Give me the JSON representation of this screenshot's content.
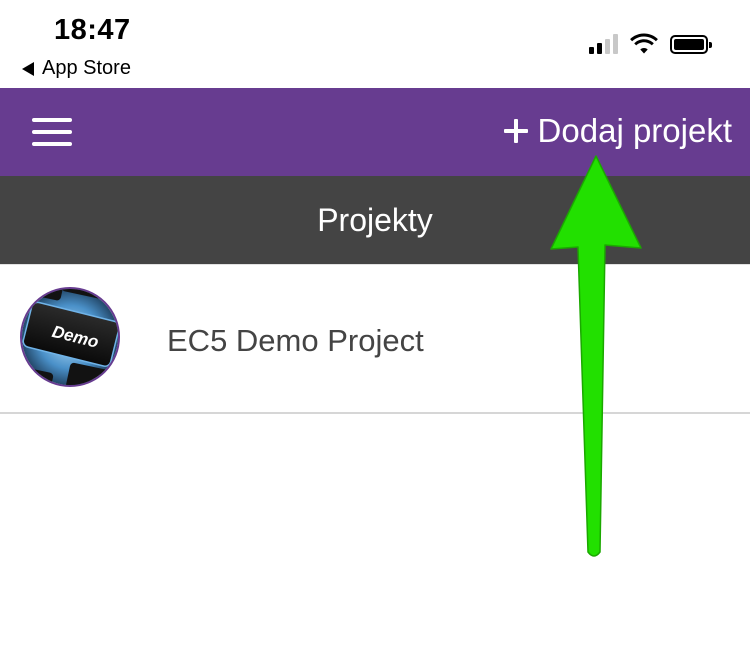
{
  "status_bar": {
    "time": "18:47",
    "back_label": "App Store",
    "signal_bars_filled": 2,
    "signal_bars_total": 4,
    "battery_level": 1.0,
    "icons": [
      "cellular-signal-icon",
      "wifi-icon",
      "battery-icon"
    ]
  },
  "app_bar": {
    "background_color": "#673c90",
    "menu_icon": "hamburger-menu-icon",
    "add_project_label": "Dodaj projekt",
    "add_icon": "plus-icon"
  },
  "title_bar": {
    "background_color": "#444444",
    "title": "Projekty"
  },
  "projects": [
    {
      "name": "EC5 Demo Project",
      "logo_text": "Demo"
    }
  ],
  "annotation": {
    "type": "arrow",
    "color": "#22e000",
    "points_to": "add-project-button"
  }
}
